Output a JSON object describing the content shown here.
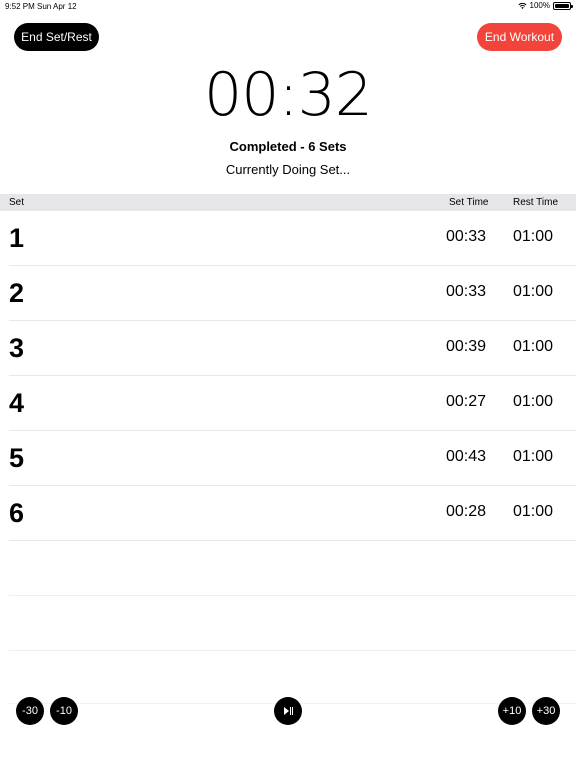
{
  "status_bar": {
    "time": "9:52 PM",
    "date": "Sun Apr 12",
    "battery": "100%"
  },
  "header": {
    "end_set_label": "End Set/Rest",
    "end_workout_label": "End Workout"
  },
  "timer": {
    "display": "00:32"
  },
  "summary": {
    "completed": "Completed - 6 Sets",
    "currently": "Currently Doing Set..."
  },
  "table": {
    "headers": {
      "set": "Set",
      "set_time": "Set Time",
      "rest_time": "Rest Time"
    },
    "rows": [
      {
        "set": "1",
        "set_time": "00:33",
        "rest_time": "01:00"
      },
      {
        "set": "2",
        "set_time": "00:33",
        "rest_time": "01:00"
      },
      {
        "set": "3",
        "set_time": "00:39",
        "rest_time": "01:00"
      },
      {
        "set": "4",
        "set_time": "00:27",
        "rest_time": "01:00"
      },
      {
        "set": "5",
        "set_time": "00:43",
        "rest_time": "01:00"
      },
      {
        "set": "6",
        "set_time": "00:28",
        "rest_time": "01:00"
      }
    ]
  },
  "controls": {
    "minus30": "-30",
    "minus10": "-10",
    "plus10": "+10",
    "plus30": "+30",
    "play_pause_icon": "play-pause-icon"
  },
  "colors": {
    "accent_red": "#f2443a",
    "button_black": "#000000",
    "header_gray": "#e6e6ea"
  }
}
